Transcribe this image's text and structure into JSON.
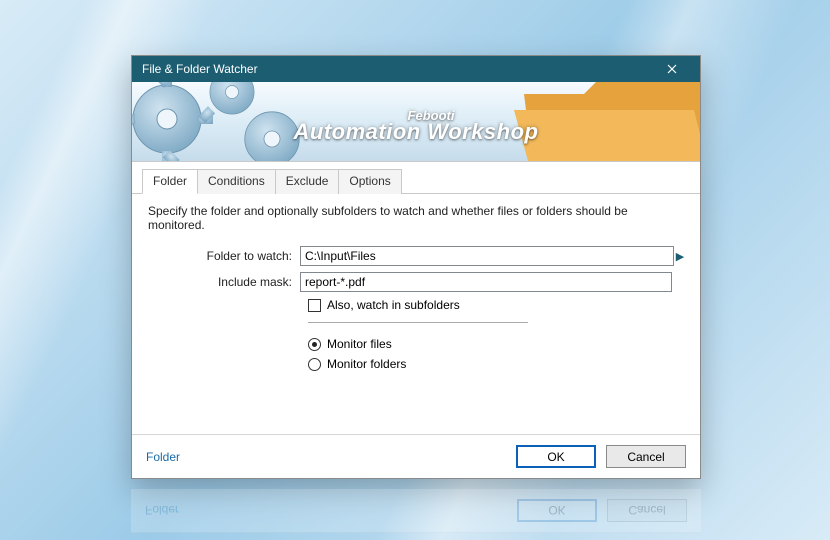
{
  "titlebar": {
    "title": "File & Folder Watcher"
  },
  "banner": {
    "brand_small": "Febooti",
    "brand_big": "Automation Workshop"
  },
  "tabs": [
    {
      "label": "Folder",
      "active": true
    },
    {
      "label": "Conditions",
      "active": false
    },
    {
      "label": "Exclude",
      "active": false
    },
    {
      "label": "Options",
      "active": false
    }
  ],
  "pane": {
    "description": "Specify the folder and optionally subfolders to watch and whether files or folders should be monitored.",
    "folder_label": "Folder to watch:",
    "folder_value": "C:\\Input\\Files",
    "mask_label": "Include mask:",
    "mask_value": "report-*.pdf",
    "subfolders_label": "Also, watch in subfolders",
    "subfolders_checked": false,
    "monitor_files_label": "Monitor files",
    "monitor_folders_label": "Monitor folders",
    "monitor_selection": "files"
  },
  "footer": {
    "status": "Folder",
    "ok": "OK",
    "cancel": "Cancel"
  }
}
